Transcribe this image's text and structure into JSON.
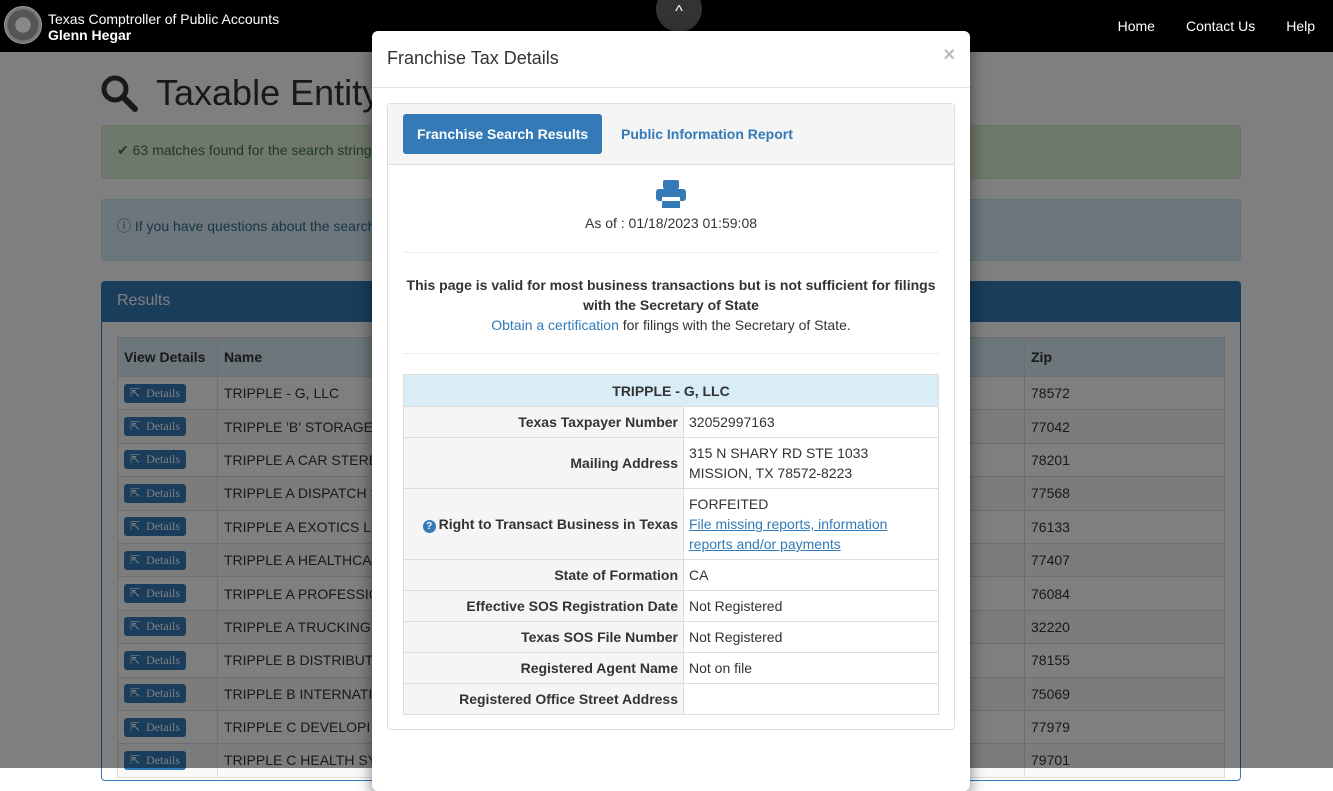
{
  "header": {
    "agency": "Texas Comptroller of Public Accounts",
    "official": "Glenn Hegar",
    "nav": [
      "Home",
      "Contact Us",
      "Help"
    ]
  },
  "page": {
    "title": "Taxable Entity",
    "success_alert": "63 matches found for the search string",
    "info_alert": "If you have questions about the search",
    "results": {
      "title": "Results",
      "columns": [
        "View Details",
        "Name",
        "Zip"
      ],
      "button_label": "Details",
      "rows": [
        [
          "TRIPPLE - G, LLC",
          "78572"
        ],
        [
          "TRIPPLE 'B' STORAGE",
          "77042"
        ],
        [
          "TRIPPLE A CAR STERE",
          "78201"
        ],
        [
          "TRIPPLE A DISPATCH S",
          "77568"
        ],
        [
          "TRIPPLE A EXOTICS LL",
          "76133"
        ],
        [
          "TRIPPLE A HEALTHCA",
          "77407"
        ],
        [
          "TRIPPLE A PROFESSIO",
          "76084"
        ],
        [
          "TRIPPLE A TRUCKING",
          "32220"
        ],
        [
          "TRIPPLE B DISTRIBUT",
          "78155"
        ],
        [
          "TRIPPLE B INTERNATI",
          "75069"
        ],
        [
          "TRIPPLE C DEVELOPI",
          "77979"
        ],
        [
          "TRIPPLE C HEALTH SY",
          "79701"
        ]
      ]
    }
  },
  "modal": {
    "title": "Franchise Tax Details",
    "close": "×",
    "tabs": [
      "Franchise Search Results",
      "Public Information Report"
    ],
    "as_of": "As of : 01/18/2023 01:59:08",
    "notice_bold": "This page is valid for most business transactions but is not sufficient for filings with the Secretary of State",
    "cert_link": "Obtain a certification",
    "cert_rest": " for filings with the Secretary of State.",
    "entity": "TRIPPLE - G, LLC",
    "fields": {
      "taxpayer_label": "Texas Taxpayer Number",
      "taxpayer": "32052997163",
      "mail_label": "Mailing Address",
      "mail1": "315 N SHARY RD STE 1033",
      "mail2": "MISSION, TX 78572-8223",
      "right_label": "Right to Transact Business in Texas",
      "right_status": "FORFEITED",
      "right_link": "File missing reports, information reports and/or payments",
      "formation_label": "State of Formation",
      "formation": "CA",
      "sos_date_label": "Effective SOS Registration Date",
      "sos_date": "Not Registered",
      "sos_file_label": "Texas SOS File Number",
      "sos_file": "Not Registered",
      "agent_label": "Registered Agent Name",
      "agent": "Not on file",
      "office_label": "Registered Office Street Address",
      "office": ""
    }
  }
}
